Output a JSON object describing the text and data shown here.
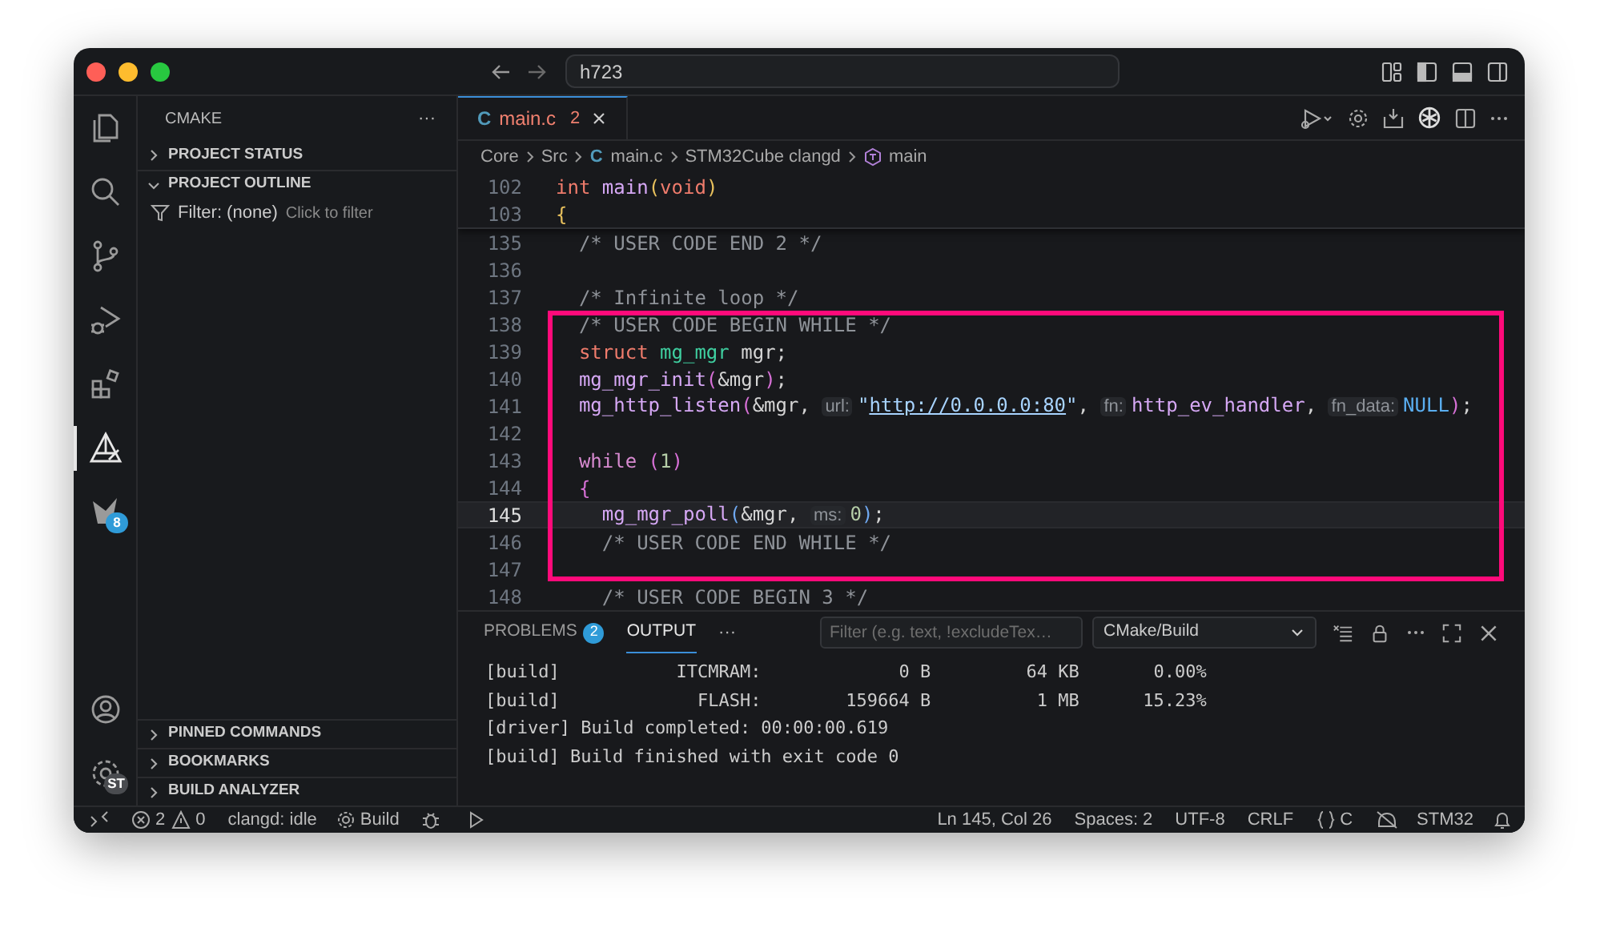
{
  "window": {
    "search": "h723"
  },
  "activity_bar": {
    "items": [
      {
        "kind": "explorer",
        "selected": false
      },
      {
        "kind": "search",
        "selected": false
      },
      {
        "kind": "scm",
        "selected": false
      },
      {
        "kind": "debug",
        "selected": false
      },
      {
        "kind": "extensions",
        "selected": false
      },
      {
        "kind": "cmake",
        "selected": true
      },
      {
        "kind": "stm32",
        "selected": false,
        "badge": "8"
      }
    ],
    "bottom_items": [
      {
        "kind": "account"
      },
      {
        "kind": "settings",
        "badge": "ST"
      }
    ]
  },
  "sidebar": {
    "title": "CMAKE",
    "more": "···",
    "sections": [
      {
        "label": "PROJECT STATUS",
        "expanded": false
      },
      {
        "label": "PROJECT OUTLINE",
        "expanded": true,
        "filter_label": "Filter: (none)",
        "filter_hint": "Click to filter"
      }
    ],
    "bottom_sections": [
      {
        "label": "PINNED COMMANDS",
        "expanded": false
      },
      {
        "label": "BOOKMARKS",
        "expanded": false
      },
      {
        "label": "BUILD ANALYZER",
        "expanded": false
      }
    ]
  },
  "tabs": [
    {
      "icon": "C",
      "label": "main.c",
      "problems": "2",
      "selected": true
    }
  ],
  "breadcrumbs": [
    {
      "kind": "folder",
      "text": "Core"
    },
    {
      "kind": "folder",
      "text": "Src"
    },
    {
      "kind": "file",
      "icon": "C",
      "text": "main.c"
    },
    {
      "kind": "folder",
      "text": "STM32Cube clangd"
    },
    {
      "kind": "symbol",
      "text": "main"
    }
  ],
  "editor": {
    "sticky_lines": [
      {
        "number": "102",
        "tokens": [
          {
            "kind": "keyword",
            "text": "int "
          },
          {
            "kind": "function",
            "text": "main"
          },
          {
            "kind": "bracket",
            "text": "("
          },
          {
            "kind": "keyword",
            "text": "void"
          },
          {
            "kind": "bracket",
            "text": ")"
          }
        ]
      },
      {
        "number": "103",
        "tokens": [
          {
            "kind": "bracket",
            "text": "{"
          }
        ]
      }
    ],
    "lines": [
      {
        "number": "135",
        "current": false,
        "tokens": [
          {
            "kind": "comment",
            "text": "  /* USER CODE END 2 */"
          }
        ]
      },
      {
        "number": "136",
        "current": false
      },
      {
        "number": "137",
        "current": false,
        "tokens": [
          {
            "kind": "comment",
            "text": "  /* Infinite loop */"
          }
        ]
      },
      {
        "number": "138",
        "current": false,
        "tokens": [
          {
            "kind": "comment",
            "text": "  /* USER CODE BEGIN WHILE */"
          }
        ]
      },
      {
        "number": "139",
        "current": false,
        "tokens": [
          {
            "kind": "keyword",
            "text": "  struct "
          },
          {
            "kind": "type",
            "text": "mg_mgr"
          },
          {
            "kind": "plain",
            "text": " mgr;"
          }
        ]
      },
      {
        "number": "140",
        "current": false,
        "tokens": [
          {
            "kind": "function",
            "text": "  mg_mgr_init"
          },
          {
            "kind": "nestedbracket",
            "text": "("
          },
          {
            "kind": "plain",
            "text": "&mgr"
          },
          {
            "kind": "nestedbracket",
            "text": ")"
          },
          {
            "kind": "plain",
            "text": ";"
          }
        ]
      },
      {
        "number": "141",
        "current": false,
        "tokens": [
          {
            "kind": "function",
            "text": "  mg_http_listen"
          },
          {
            "kind": "nestedbracket",
            "text": "("
          },
          {
            "kind": "plain",
            "text": "&mgr, "
          },
          {
            "kind": "hint",
            "text": "url:"
          },
          {
            "kind": "string",
            "text": "\""
          },
          {
            "kind": "link",
            "text": "http://0.0.0.0:80"
          },
          {
            "kind": "string",
            "text": "\""
          },
          {
            "kind": "plain",
            "text": ", "
          },
          {
            "kind": "hint",
            "text": "fn:"
          },
          {
            "kind": "function",
            "text": "http_ev_handler"
          },
          {
            "kind": "plain",
            "text": ", "
          },
          {
            "kind": "hint",
            "text": "fn_data:"
          },
          {
            "kind": "constant",
            "text": "NULL"
          },
          {
            "kind": "nestedbracket",
            "text": ")"
          },
          {
            "kind": "plain",
            "text": ";"
          }
        ]
      },
      {
        "number": "142",
        "current": false
      },
      {
        "number": "143",
        "current": false,
        "tokens": [
          {
            "kind": "control",
            "text": "  while "
          },
          {
            "kind": "nestedbracket",
            "text": "("
          },
          {
            "kind": "number",
            "text": "1"
          },
          {
            "kind": "nestedbracket",
            "text": ")"
          }
        ]
      },
      {
        "number": "144",
        "current": false,
        "tokens": [
          {
            "kind": "nestedbracket",
            "text": "  {"
          }
        ]
      },
      {
        "number": "145",
        "current": true,
        "tokens": [
          {
            "kind": "function",
            "text": "    mg_mgr_poll"
          },
          {
            "kind": "deepbracket",
            "text": "("
          },
          {
            "kind": "plain",
            "text": "&mgr, "
          },
          {
            "kind": "hint",
            "text": "ms:"
          },
          {
            "kind": "number",
            "text": "0"
          },
          {
            "kind": "deepbracket",
            "text": ")"
          },
          {
            "kind": "plain",
            "text": ";"
          }
        ]
      },
      {
        "number": "146",
        "current": false,
        "tokens": [
          {
            "kind": "comment",
            "text": "    /* USER CODE END WHILE */"
          }
        ]
      },
      {
        "number": "147",
        "current": false
      },
      {
        "number": "148",
        "current": false,
        "tokens": [
          {
            "kind": "comment",
            "text": "    /* USER CODE BEGIN 3 */"
          }
        ]
      }
    ]
  },
  "panel": {
    "tabs": [
      {
        "label": "PROBLEMS",
        "badge": "2",
        "selected": false
      },
      {
        "label": "OUTPUT",
        "selected": true
      }
    ],
    "more": "···",
    "filter": {
      "placeholder": "Filter (e.g. text, !excludeTex…"
    },
    "channel": "CMake/Build",
    "output": [
      "[build]           ITCMRAM:             0 B         64 KB       0.00%",
      "[build]             FLASH:        159664 B          1 MB      15.23%",
      "[driver] Build completed: 00:00:00.619",
      "[build] Build finished with exit code 0"
    ]
  },
  "status_bar": {
    "errors": "2",
    "warnings": "0",
    "language_server": "clangd: idle",
    "build": "Build",
    "position": "Ln 145, Col 26",
    "indentation": "Spaces: 2",
    "encoding": "UTF-8",
    "eol": "CRLF",
    "language": "C",
    "board": "STM32"
  }
}
